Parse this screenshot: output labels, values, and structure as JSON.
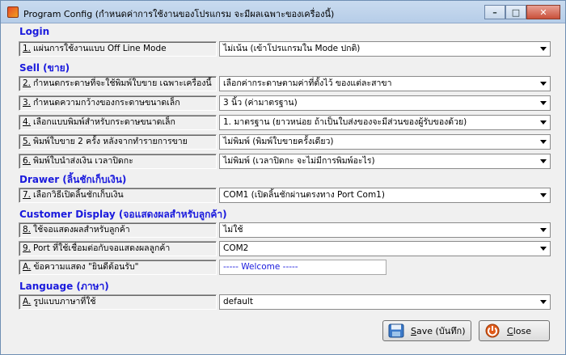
{
  "window": {
    "title": "Program Config (กำหนดค่าการใช้งานของโปรแกรม จะมีผลเฉพาะของเครื่องนี้)",
    "minimize_icon": "minimize-icon",
    "maximize_icon": "maximize-icon",
    "close_icon": "close-icon"
  },
  "sections": {
    "login": "Login",
    "sell": "Sell (ขาย)",
    "drawer": "Drawer (ลิ้นชักเก็บเงิน)",
    "customer_display": "Customer Display (จอแสดงผลสำหรับลูกค้า)",
    "language": "Language (ภาษา)"
  },
  "rows": {
    "offline": {
      "num": "1.",
      "label": "แผ่นการใช้งานแบบ Off Line Mode",
      "value": "ไม่เน้น (เข้าโปรแกรมใน Mode ปกติ)"
    },
    "sell_paper": {
      "num": "2.",
      "label": "กำหนดกระดาษที่จะใช้พิมพ์ใบขาย เฉพาะเครื่องนี้",
      "value": "เลือกค่ากระดาษตามค่าที่ตั้งไว้ ของแต่ละสาขา"
    },
    "paper_width": {
      "num": "3.",
      "label": "กำหนดความกว้างของกระดาษขนาดเล็ก",
      "value": "3 นิ้ว (ค่ามาตรฐาน)"
    },
    "print_format": {
      "num": "4.",
      "label": "เลือกแบบพิมพ์สำหรับกระดาษขนาดเล็ก",
      "value": "1. มาตรฐาน (ยาวหน่อย ถ้าเป็นใบส่งของจะมีส่วนของผู้รับของด้วย)"
    },
    "print_twice": {
      "num": "5.",
      "label": "พิมพ์ใบขาย 2 ครั้ง หลังจากทำรายการขาย",
      "value": "ไม่พิมพ์ (พิมพ์ใบขายครั้งเดียว)"
    },
    "print_delivery": {
      "num": "6.",
      "label": "พิมพ์ใบนำส่งเงิน เวลาปิดกะ",
      "value": "ไม่พิมพ์ (เวลาปิดกะ จะไม่มีการพิมพ์อะไร)"
    },
    "drawer_open": {
      "num": "7.",
      "label": "เลือกวิธีเปิดลิ้นชักเก็บเงิน",
      "value": "COM1 (เปิดลิ้นชักผ่านตรงทาง Port Com1)"
    },
    "use_display": {
      "num": "8.",
      "label": "ใช้จอแสดงผลสำหรับลูกค้า",
      "value": "ไม่ใช้"
    },
    "display_port": {
      "num": "9.",
      "label": "Port ที่ใช้เชื่อมต่อกับจอแสดงผลลูกค้า",
      "value": "COM2"
    },
    "welcome_msg": {
      "num": "A.",
      "label": "ข้อความแสดง \"ยินดีต้อนรับ\"",
      "value": "----- Welcome -----"
    },
    "language": {
      "num": "A.",
      "label": "รูปแบบภาษาที่ใช้",
      "value": "default"
    }
  },
  "buttons": {
    "save_prefix": "S",
    "save_rest": "ave (บันทึก)",
    "save_icon": "save-disk-icon",
    "close_prefix": "C",
    "close_rest": "lose",
    "close_icon": "power-icon"
  },
  "colors": {
    "section_heading": "#1a1add",
    "window_bg": "#f0f0f0"
  }
}
